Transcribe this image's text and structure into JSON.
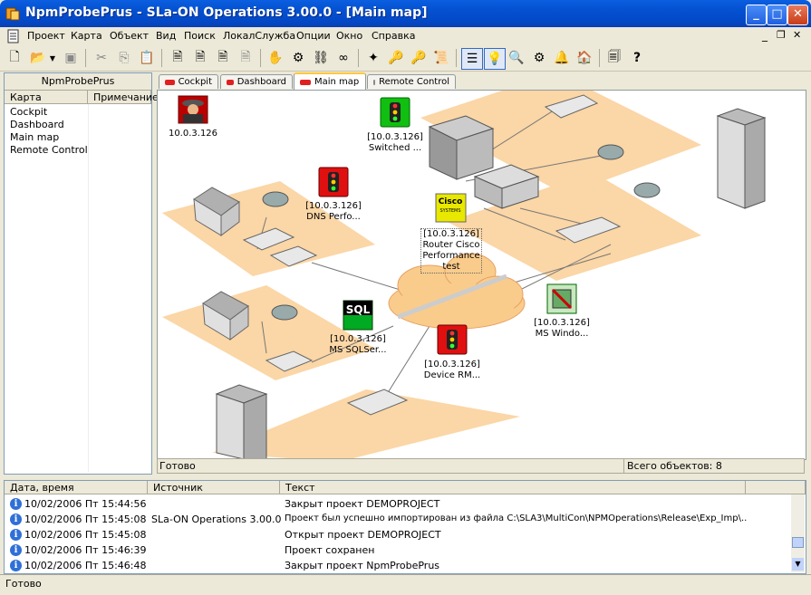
{
  "window": {
    "title": "NpmProbePrus - SLa-ON Operations 3.00.0 - [Main map]"
  },
  "menu": [
    "Проект",
    "Карта",
    "Объект",
    "Вид",
    "Поиск",
    "ЛокалСлужба",
    "Опции",
    "Окно",
    "Справка"
  ],
  "left_panel": {
    "title": "NpmProbePrus",
    "columns": [
      "Карта",
      "Примечание"
    ],
    "rows": [
      "Cockpit",
      "Dashboard",
      "Main map",
      "Remote Control"
    ]
  },
  "tabs": [
    "Cockpit",
    "Dashboard",
    "Main map",
    "Remote Control"
  ],
  "selected_tab": "Main map",
  "map_nodes": {
    "spy": [
      "10.0.3.126"
    ],
    "switched": [
      "[10.0.3.126]",
      "Switched ..."
    ],
    "dns": [
      "[10.0.3.126]",
      "DNS Perfo..."
    ],
    "cisco": [
      "[10.0.3.126]",
      "Router Cisco",
      "Performance",
      "test"
    ],
    "cisco_logo": [
      "Cisco",
      "SYSTEMS"
    ],
    "sql": [
      "[10.0.3.126]",
      "MS SQLSer..."
    ],
    "sql_logo": "SQL",
    "device": [
      "[10.0.3.126]",
      "Device RM..."
    ],
    "windows": [
      "[10.0.3.126]",
      "MS Windo..."
    ]
  },
  "map_status": {
    "left": "Готово",
    "right": "Всего объектов: 8"
  },
  "log": {
    "columns": [
      "Дата, время",
      "Источник",
      "Текст"
    ],
    "rows": [
      {
        "time": "10/02/2006 Пт 15:44:56",
        "source": "",
        "text": "Закрыт проект DEMOPROJECT"
      },
      {
        "time": "10/02/2006 Пт 15:45:08",
        "source": "SLa-ON Operations 3.00.0",
        "text": "Проект был успешно импортирован из файла C:\\SLA3\\MultiCon\\NPMOperations\\Release\\Exp_Imp\\..."
      },
      {
        "time": "10/02/2006 Пт 15:45:08",
        "source": "",
        "text": "Открыт проект DEMOPROJECT"
      },
      {
        "time": "10/02/2006 Пт 15:46:39",
        "source": "",
        "text": "Проект сохранен"
      },
      {
        "time": "10/02/2006 Пт 15:46:48",
        "source": "",
        "text": "Закрыт проект NpmProbePrus"
      }
    ]
  },
  "status": "Готово",
  "colors": {
    "titlebar": "#0450d0",
    "zone": "#fbd6a6",
    "alarm": "#e01010",
    "ok": "#10c010"
  }
}
